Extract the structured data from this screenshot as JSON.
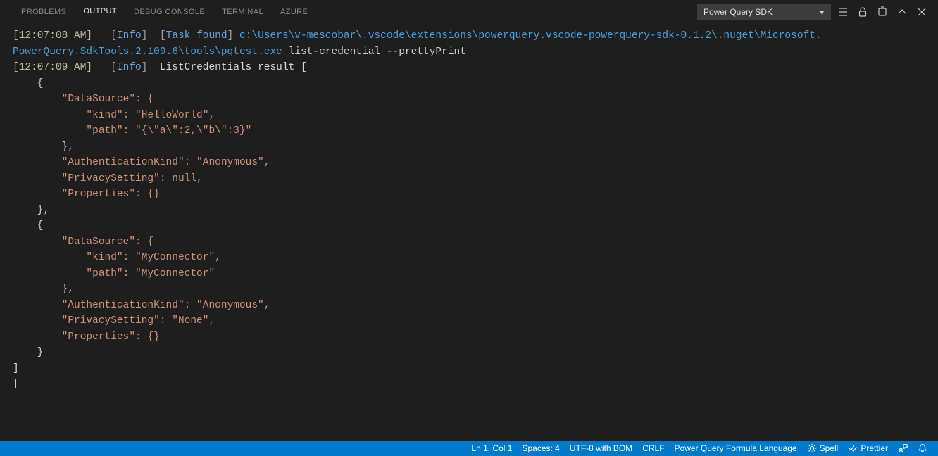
{
  "panel": {
    "tabs": {
      "problems": "PROBLEMS",
      "output": "OUTPUT",
      "debug_console": "DEBUG CONSOLE",
      "terminal": "TERMINAL",
      "azure": "AZURE"
    },
    "channel_selected": "Power Query SDK"
  },
  "log": {
    "line1": {
      "ts": "[12:07:08 AM]",
      "lb": "[",
      "info": "Info",
      "rb": "]",
      "lb2": "[",
      "task": "Task found",
      "rb2": "]",
      "path1": "c:\\Users\\v-mescobar\\.vscode\\extensions\\powerquery.vscode-powerquery-sdk-0.1.2\\.nuget\\Microsoft."
    },
    "line2": {
      "path2": "PowerQuery.SdkTools.2.109.6\\tools\\pqtest.exe",
      "args": " list-credential --prettyPrint"
    },
    "line3": {
      "ts": "[12:07:09 AM]",
      "lb": "[",
      "info": "Info",
      "rb": "]",
      "msg": "  ListCredentials result ["
    },
    "json": {
      "open1": "    {",
      "ds1a": "        \"DataSource\": {",
      "ds1b": "            \"kind\": \"HelloWorld\",",
      "ds1c": "            \"path\": \"{\\\"a\\\":2,\\\"b\\\":3}\"",
      "ds1d": "        },",
      "ak1": "        \"AuthenticationKind\": \"Anonymous\",",
      "ps1": "        \"PrivacySetting\": null,",
      "pr1": "        \"Properties\": {}",
      "close1": "    },",
      "open2": "    {",
      "ds2a": "        \"DataSource\": {",
      "ds2b": "            \"kind\": \"MyConnector\",",
      "ds2c": "            \"path\": \"MyConnector\"",
      "ds2d": "        },",
      "ak2": "        \"AuthenticationKind\": \"Anonymous\",",
      "ps2": "        \"PrivacySetting\": \"None\",",
      "pr2": "        \"Properties\": {}",
      "close2": "    }",
      "end": "]",
      "cursor": "|"
    }
  },
  "status": {
    "position": "Ln 1, Col 1",
    "indent": "Spaces: 4",
    "encoding": "UTF-8 with BOM",
    "eol": "CRLF",
    "language": "Power Query Formula Language",
    "spell": "Spell",
    "prettier": "Prettier"
  }
}
